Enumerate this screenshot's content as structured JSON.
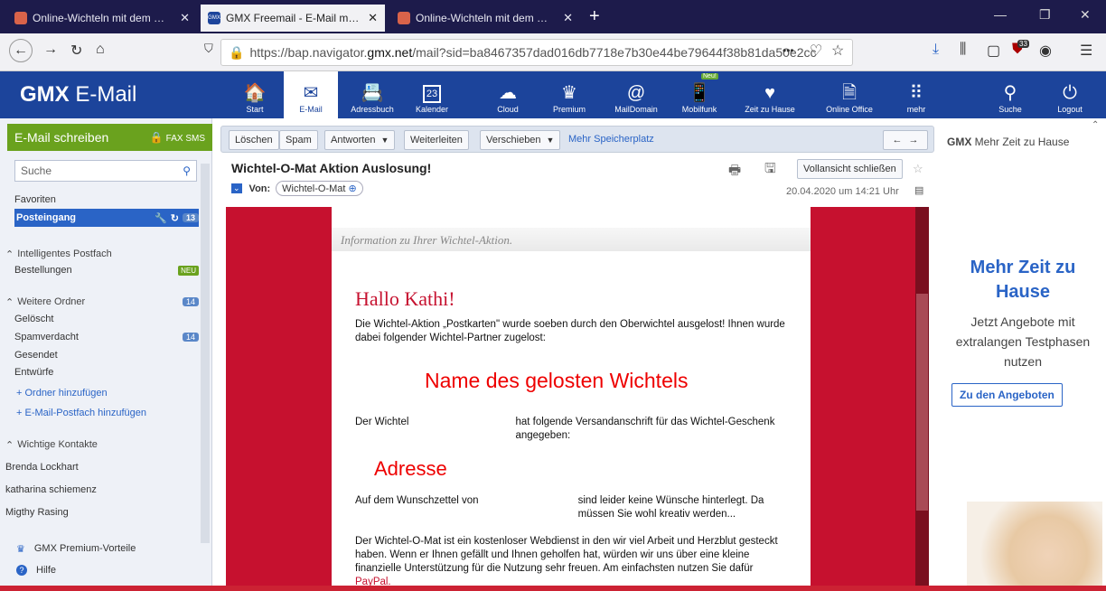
{
  "browser": {
    "tabs": [
      {
        "label": "Online-Wichteln mit dem Wich",
        "active": false
      },
      {
        "label": "GMX Freemail - E-Mail made in",
        "active": true
      },
      {
        "label": "Online-Wichteln mit dem Wich",
        "active": false
      }
    ],
    "new_tab": "+",
    "url_prefix": "https://bap.navigator.",
    "url_domain": "gmx.net",
    "url_rest": "/mail?sid=ba8467357dad016db7718e7b30e44be79644f38b81da50e2cc",
    "url_dots": "•••",
    "ext_badge": "33"
  },
  "gmx": {
    "logo_bold": "GMX",
    "logo_rest": " E-Mail",
    "nav": [
      {
        "label": "Start",
        "icon": "🏠"
      },
      {
        "label": "E-Mail",
        "icon": "✉"
      },
      {
        "label": "Adressbuch",
        "icon": "📇"
      },
      {
        "label": "Kalender",
        "icon": "23"
      },
      {
        "label": "Cloud",
        "icon": "☁"
      },
      {
        "label": "Premium",
        "icon": "♛"
      },
      {
        "label": "MailDomain",
        "icon": "@"
      },
      {
        "label": "Mobilfunk",
        "icon": "📱"
      },
      {
        "label": "Zeit zu Hause",
        "icon": "♥"
      },
      {
        "label": "Online Office",
        "icon": "🗎"
      },
      {
        "label": "mehr",
        "icon": "⠿"
      }
    ],
    "nav_new_badge": "Neu!",
    "search_label": "Suche",
    "logout_label": "Logout"
  },
  "sidebar": {
    "compose": "E-Mail schreiben",
    "fax": "FAX",
    "sms": "SMS",
    "search_placeholder": "Suche",
    "favorites": "Favoriten",
    "inbox": "Posteingang",
    "inbox_count": "13",
    "smart_folder": "Intelligentes Postfach",
    "orders": "Bestellungen",
    "orders_badge": "NEU",
    "more_folders": "Weitere Ordner",
    "more_folders_count": "14",
    "deleted": "Gelöscht",
    "spam": "Spamverdacht",
    "spam_count": "14",
    "sent": "Gesendet",
    "drafts": "Entwürfe",
    "add_folder": "+ Ordner hinzufügen",
    "add_mailbox": "+ E-Mail-Postfach hinzufügen",
    "contacts_header": "Wichtige Kontakte",
    "contacts": [
      "Brenda Lockhart",
      "katharina schiemenz",
      "Migthy Rasing"
    ],
    "premium": "GMX Premium-Vorteile",
    "help": "Hilfe"
  },
  "toolbar": {
    "delete": "Löschen",
    "spam": "Spam",
    "reply": "Antworten",
    "forward": "Weiterleiten",
    "move": "Verschieben",
    "more_storage": "Mehr Speicherplatz"
  },
  "mail": {
    "subject": "Wichtel-O-Mat Aktion Auslosung!",
    "from_label": "Von:",
    "from_name": "Wichtel-O-Mat",
    "date": "20.04.2020 um 14:21 Uhr",
    "fullview_close": "Vollansicht schließen",
    "info_strip": "Information zu Ihrer Wichtel-Aktion.",
    "greeting": "Hallo Kathi!",
    "p1": "Die Wichtel-Aktion „Postkarten\" wurde soeben durch den Oberwichtel ausgelost! Ihnen wurde dabei folgender Wichtel-Partner zugelost:",
    "overlay_name": "Name des gelosten Wichtels",
    "p2a": "Der Wichtel",
    "p2b": "hat folgende Versandanschrift für das Wichtel-Geschenk angegeben:",
    "overlay_address": "Adresse",
    "p3a": "Auf dem Wunschzettel von",
    "p3b": "sind leider keine Wünsche hinterlegt. Da müssen Sie wohl kreativ werden...",
    "p4": "Der Wichtel-O-Mat ist ein kostenloser Webdienst in den wir viel Arbeit und Herzblut gesteckt haben. Wenn er Ihnen gefällt und Ihnen geholfen hat, würden wir uns über eine kleine finanzielle Unterstützung für die Nutzung sehr freuen. Am einfachsten nutzen Sie dafür",
    "paypal": "PayPal."
  },
  "ad": {
    "brand": "GMX",
    "title": " Mehr Zeit zu Hause",
    "headline": "Mehr Zeit zu Hause",
    "sub": "Jetzt Angebote mit extralangen Testphasen nutzen",
    "button": "Zu den Angeboten"
  },
  "colors": {
    "gmx_blue": "#1c449b",
    "compose_green": "#6aa21e",
    "mail_red": "#c6112f"
  }
}
